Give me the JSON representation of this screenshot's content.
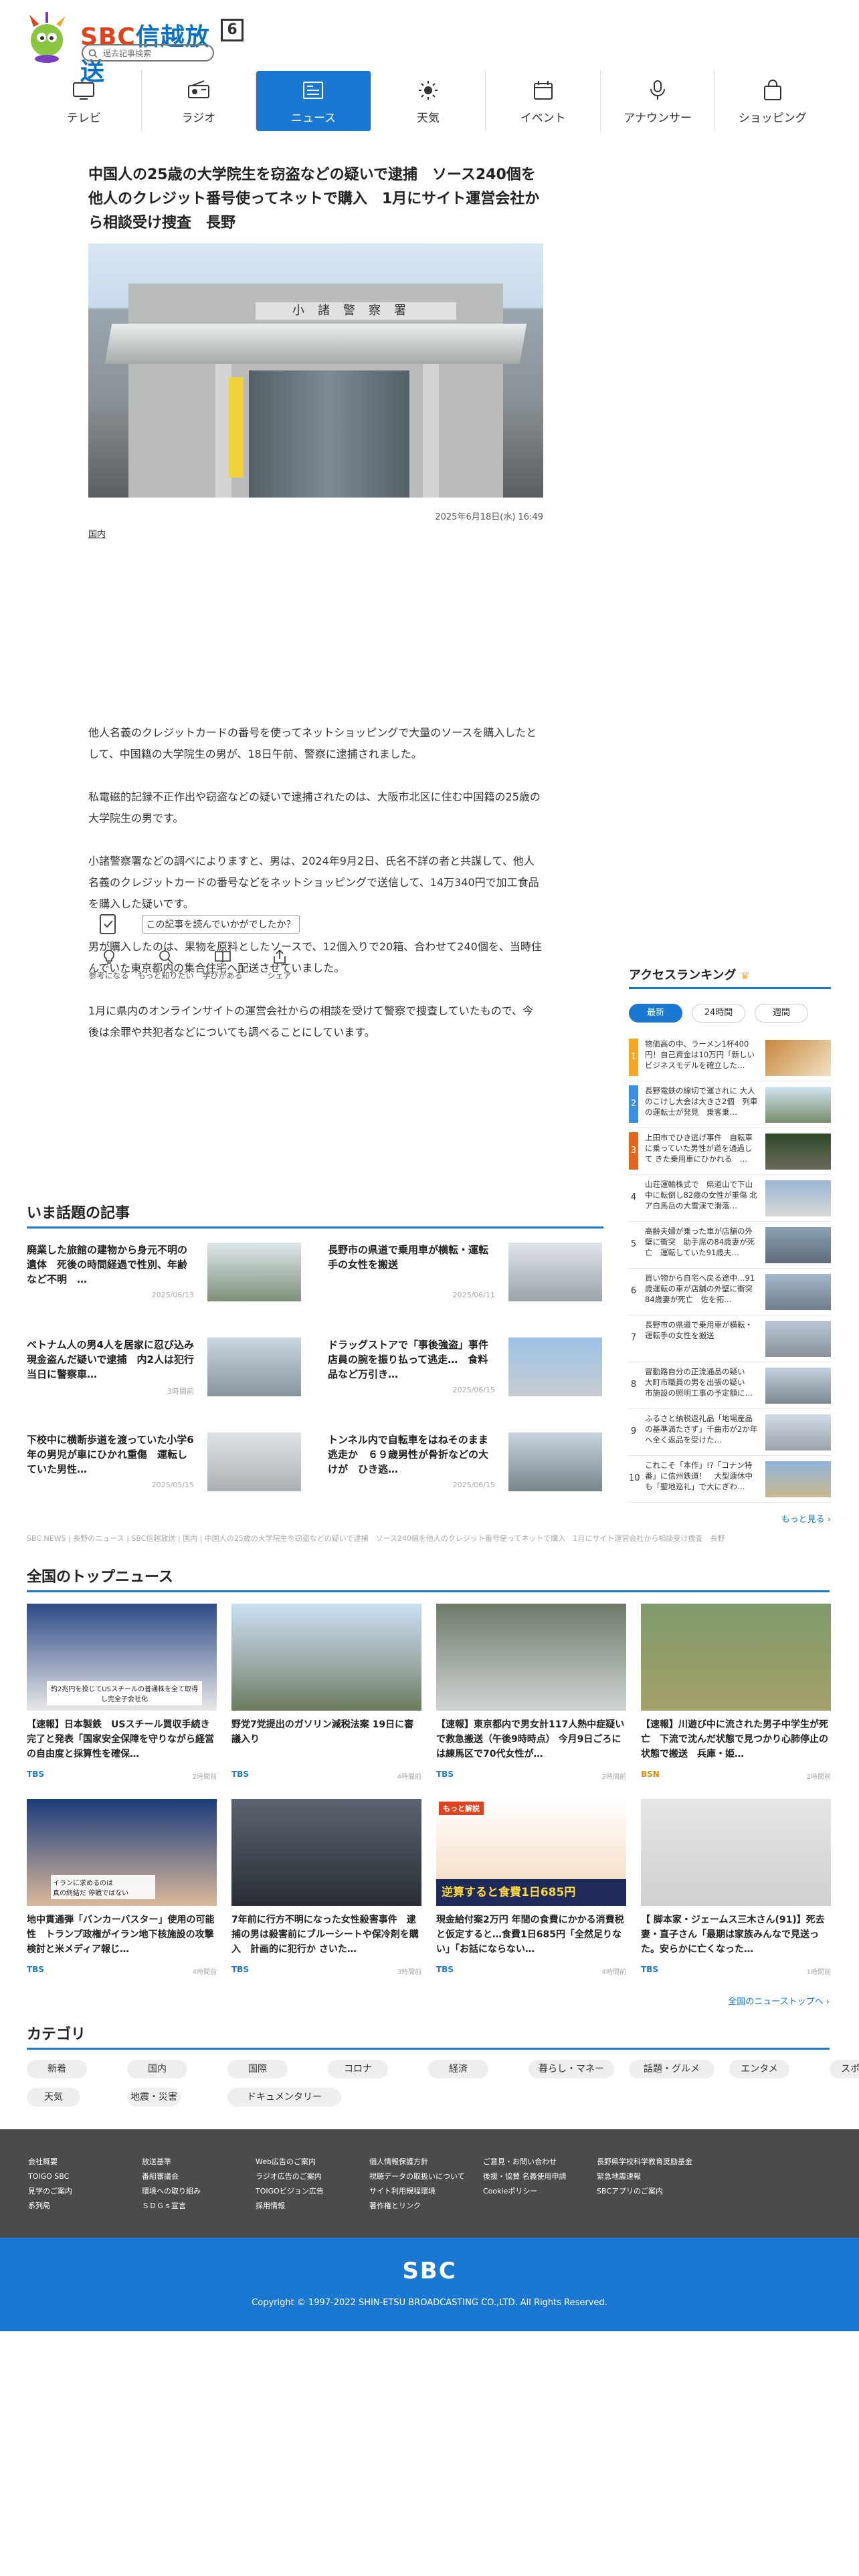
{
  "header": {
    "logo_brand": "SBC",
    "logo_name": "信越放送",
    "logo_channel": "6",
    "search_placeholder": "過去記事検索",
    "nav": [
      {
        "label": "テレビ",
        "icon": "tv-icon"
      },
      {
        "label": "ラジオ",
        "icon": "radio-icon"
      },
      {
        "label": "ニュース",
        "icon": "news-icon",
        "active": true
      },
      {
        "label": "天気",
        "icon": "sun-icon"
      },
      {
        "label": "イベント",
        "icon": "calendar-icon"
      },
      {
        "label": "アナウンサー",
        "icon": "microphone-icon"
      },
      {
        "label": "ショッピング",
        "icon": "shopping-bag-icon"
      }
    ]
  },
  "article": {
    "headline": "中国人の25歳の大学院生を窃盗などの疑いで逮捕　ソース240個を他人のクレジット番号使ってネットで購入　1月にサイト運営会社から相談受け捜査　長野",
    "photo_sign": "小諸警察署",
    "date": "2025年6月18日(水) 16:49",
    "category": "国内",
    "paragraphs": [
      "他人名義のクレジットカードの番号を使ってネットショッピングで大量のソースを購入したとして、中国籍の大学院生の男が、18日午前、警察に逮捕されました。",
      "私電磁的記録不正作出や窃盗などの疑いで逮捕されたのは、大阪市北区に住む中国籍の25歳の大学院生の男です。",
      "小諸警察署などの調べによりますと、男は、2024年9月2日、氏名不詳の者と共謀して、他人名義のクレジットカードの番号などをネットショッピングで送信して、14万340円で加工食品を購入した疑いです。",
      "男が購入したのは、果物を原料としたソースで、12個入りで20箱、合わせて240個を、当時住んでいた東京都内の集合住宅へ配送させていました。",
      "1月に県内のオンラインサイトの運営会社からの相談を受けて警察で捜査していたもので、今後は余罪や共犯者などについても調べることにしています。"
    ],
    "reaction_prompt": "この記事を読んでいかがでしたか？",
    "reactions": [
      "参考になる",
      "もっと知りたい",
      "学びがある",
      "シェア"
    ]
  },
  "ranking": {
    "title": "アクセスランキング",
    "tabs": [
      "最新",
      "24時間",
      "週間"
    ],
    "items": [
      "物価高の中、ラーメン1杯400円！自己資金は10万円「新しいビジネスモデルを確立した…",
      "長野電鉄の線切で運されに 大人のこけし大会は大きさ2個　列車の運転士が発見　乗客乗…",
      "上田市でひき逃げ事件　自転車に乗っていた男性が道を通過して きた乗用車にひかれる　…",
      "山荘運輸株式で　県道山で下山中に転倒し82歳の女性が重傷 北ア白馬岳の大雪渓で滑落…",
      "高齢夫婦が乗った車が店舗の外壁に衝突　助手席の84歳妻が死亡　運転していた91歳夫…",
      "買い物から自宅へ戻る途中…91歳運転の車が店舗の外壁に衝突 84歳妻が死亡　佐を拓…",
      "長野市の県道で乗用車が横転・運転手の女性を搬送",
      "冒勤路自分の正流通品の疑い　大町市職員の男を出張の疑い　市施設の照明工事の予定額に…",
      "ふるさと納税返礼品「地場産品の基準満たさず」千曲市が2か年へ全く返品を受けた…",
      "これこそ「本作」!?「コナン特番」に信州鉄道！　大型連休中も「聖地巡礼」で大にぎわ…"
    ],
    "more": "もっと見る"
  },
  "topics": {
    "title": "いま話題の記事",
    "items": [
      {
        "text": "廃業した旅館の建物から身元不明の遺体　死後の時間経過で性別、年齢など不明　…",
        "date": "2025/06/13"
      },
      {
        "text": "長野市の県道で乗用車が横転・運転手の女性を搬送",
        "date": "2025/06/11"
      },
      {
        "text": "ベトナム人の男4人を居家に忍び込み現金盗んだ疑いで逮捕　内2人は犯行当日に警察車…",
        "date": "3時間前"
      },
      {
        "text": "ドラッグストアで「事後強盗」事件　店員の腕を振り払って逃走…　食料品など万引き…",
        "date": "2025/06/15"
      },
      {
        "text": "下校中に横断歩道を渡っていた小学6年の男児が車にひかれ重傷　運転していた男性…",
        "date": "2025/05/15"
      },
      {
        "text": "トンネル内で自転車をはねそのまま逃走か　６９歳男性が骨折などの大けが　ひき逃…",
        "date": "2025/06/15"
      }
    ]
  },
  "breadcrumb": "SBC NEWS | 長野のニュース | SBC信越放送 | 国内 | 中国人の25歳の大学院生を窃盗などの疑いで逮捕　ソース240個を他人のクレジット番号使ってネットで購入　1月にサイト運営会社から相談受け捜査　長野",
  "national": {
    "title": "全国のトップニュース",
    "items": [
      {
        "text": "【速報】日本製鉄　USスチール買収手続き完了と発表「国家安全保障を守りながら経営の自由度と採算性を確保…",
        "src": "TBS",
        "time": "2時間前"
      },
      {
        "text": "野党7党提出のガソリン減税法案 19日に審議入り",
        "src": "TBS",
        "time": "4時間前"
      },
      {
        "text": "【速報】東京都内で男女計117人熱中症疑いで救急搬送（午後9時時点） 今月9日ごろには練馬区で70代女性が…",
        "src": "TBS",
        "time": "2時間前"
      },
      {
        "text": "【速報】川遊び中に流された男子中学生が死亡　下流で沈んだ状態で見つかり心肺停止の状態で搬送　兵庫・姫…",
        "src": "BSN",
        "time": "2時間前"
      },
      {
        "text": "地中貫通弾「バンカーバスター」使用の可能性　トランプ政権がイラン地下核施設の攻撃検討と米メディア報じ…",
        "src": "TBS",
        "time": "4時間前"
      },
      {
        "text": "7年前に行方不明になった女性殺害事件　逮捕の男は殺害前にブルーシートや保冷剤を購入　計画的に犯行か さいた…",
        "src": "TBS",
        "time": "3時間前"
      },
      {
        "text": "現金給付案2万円 年間の食費にかかる消費税と仮定すると…食費1日685円「全然足りない」「お話にならない…",
        "src": "TBS",
        "time": "4時間前"
      },
      {
        "text": "【 脚本家・ジェームス三木さん(91)】死去　妻・直子さん「最期は家族みんなで見送った。安らかに亡くなった…",
        "src": "TBS",
        "time": "1時間前"
      }
    ],
    "thumb_texts": {
      "uss_caption": "約2兆円を投じてUSスチールの普通株を全て取得し完全子会社化",
      "trump_caption": "イランに求めるのは\n真の終結だ 停戦ではない",
      "food_big": "逆算すると食費1日685円",
      "food_tag": "もっと解説"
    },
    "more": "全国のニューストップへ"
  },
  "category": {
    "title": "カテゴリ",
    "chips": [
      "新着",
      "国内",
      "国際",
      "コロナ",
      "経済",
      "暮らし・マネー",
      "話題・グルメ",
      "エンタメ",
      "スポーツ",
      "天気",
      "地震・災害",
      "ドキュメンタリー"
    ]
  },
  "footer": {
    "columns": [
      [
        "会社概要",
        "TOIGO SBC",
        "見学のご案内",
        "系列局"
      ],
      [
        "放送基準",
        "番組審議会",
        "環境への取り組み",
        "ＳＤＧｓ宣言"
      ],
      [
        "Web広告のご案内",
        "ラジオ広告のご案内",
        "TOIGOビジョン広告",
        "採用情報"
      ],
      [
        "個人情報保護方針",
        "視聴データの取扱いについて",
        "サイト利用規程環境",
        "著作権とリンク"
      ],
      [
        "ご意見・お問い合わせ",
        "後援・協賛 名義使用申請",
        "Cookieポリシー"
      ],
      [
        "長野県学校科学教育奨励基金",
        "緊急地震速報",
        "SBCアプリのご案内"
      ]
    ],
    "logo": "SBC",
    "copyright": "Copyright © 1997-2022 SHIN-ETSU BROADCASTING CO.,LTD. All Rights Reserved."
  },
  "colors": {
    "accent": "#1a78d2",
    "brand_red": "#e2411d",
    "rank1": "#f5a623",
    "rank2": "#3b8fe0",
    "rank3": "#e2661d",
    "footer_dark": "#4b4b4b"
  }
}
